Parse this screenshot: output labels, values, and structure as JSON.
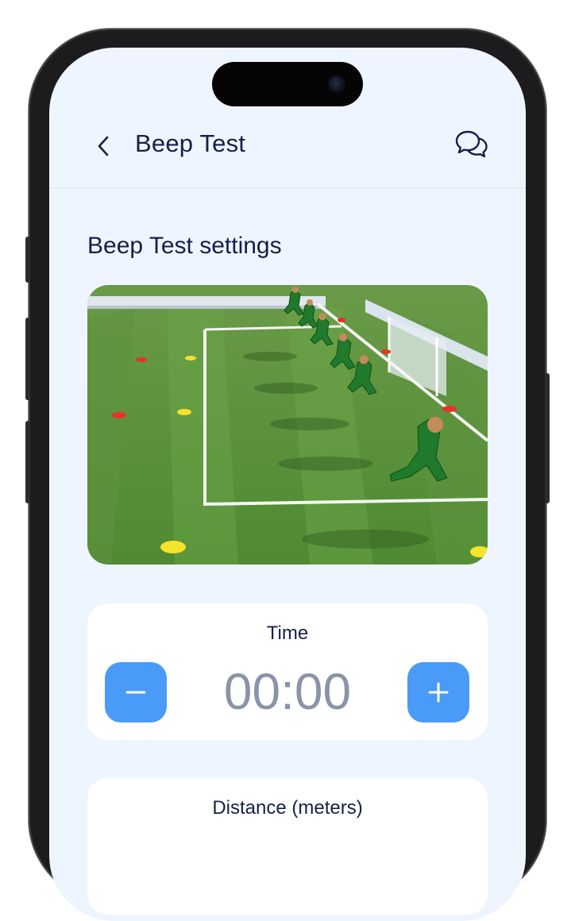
{
  "header": {
    "title": "Beep Test",
    "back_icon": "chevron-left-icon",
    "chat_icon": "chat-bubbles-icon"
  },
  "settings": {
    "title": "Beep Test settings",
    "preview_image": "beep-test-runners-illustration"
  },
  "time_card": {
    "label": "Time",
    "value": "00:00",
    "decrement_icon": "minus-icon",
    "increment_icon": "plus-icon"
  },
  "distance_card": {
    "label": "Distance (meters)"
  },
  "colors": {
    "background": "#eff5fe",
    "text_primary": "#14204a",
    "accent": "#4a9bf8",
    "value_muted": "#8c93a8"
  }
}
